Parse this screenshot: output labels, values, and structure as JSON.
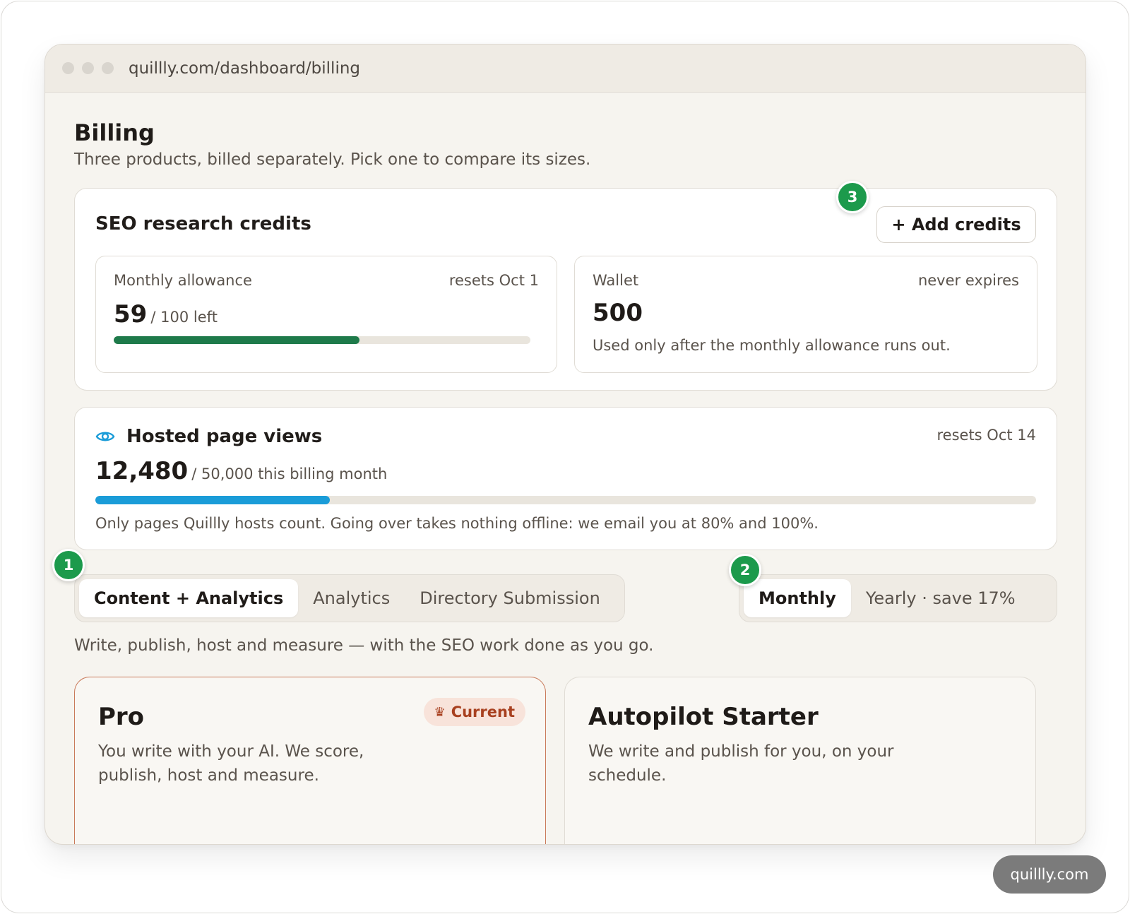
{
  "browser": {
    "url": "quillly.com/dashboard/billing"
  },
  "page": {
    "title": "Billing",
    "subtitle": "Three products, billed separately. Pick one to compare its sizes."
  },
  "seo": {
    "title": "SEO research credits",
    "add_button": "+ Add credits",
    "allowance": {
      "label": "Monthly allowance",
      "reset": "resets Oct 1",
      "value": "59",
      "of_text": "/ 100 left",
      "fraction": 0.59,
      "color": "#1e7a4a"
    },
    "wallet": {
      "label": "Wallet",
      "note_right": "never expires",
      "value": "500",
      "note": "Used only after the monthly allowance runs out."
    }
  },
  "views": {
    "icon": "eye-icon",
    "title": "Hosted page views",
    "reset": "resets Oct 14",
    "value": "12,480",
    "of_text": "/ 50,000 this billing month",
    "fraction": 0.2496,
    "color": "#1a9cd8",
    "note": "Only pages Quillly hosts count. Going over takes nothing offline: we email you at 80% and 100%."
  },
  "product_tabs": [
    {
      "label": "Content + Analytics",
      "active": true
    },
    {
      "label": "Analytics",
      "active": false
    },
    {
      "label": "Directory Submission",
      "active": false
    }
  ],
  "period_tabs": [
    {
      "label": "Monthly",
      "active": true
    },
    {
      "label": "Yearly · save 17%",
      "active": false
    }
  ],
  "badges": {
    "one": "1",
    "two": "2",
    "three": "3",
    "color": "#1c9a4c"
  },
  "product_description": "Write, publish, host and measure — with the SEO work done as you go.",
  "plans": [
    {
      "name": "Pro",
      "description": "You write with your AI. We score, publish, host and measure.",
      "badge": "Current",
      "badge_icon": "crown-icon"
    },
    {
      "name": "Autopilot Starter",
      "description": "We write and publish for you, on your schedule."
    }
  ],
  "watermark": "quillly.com"
}
